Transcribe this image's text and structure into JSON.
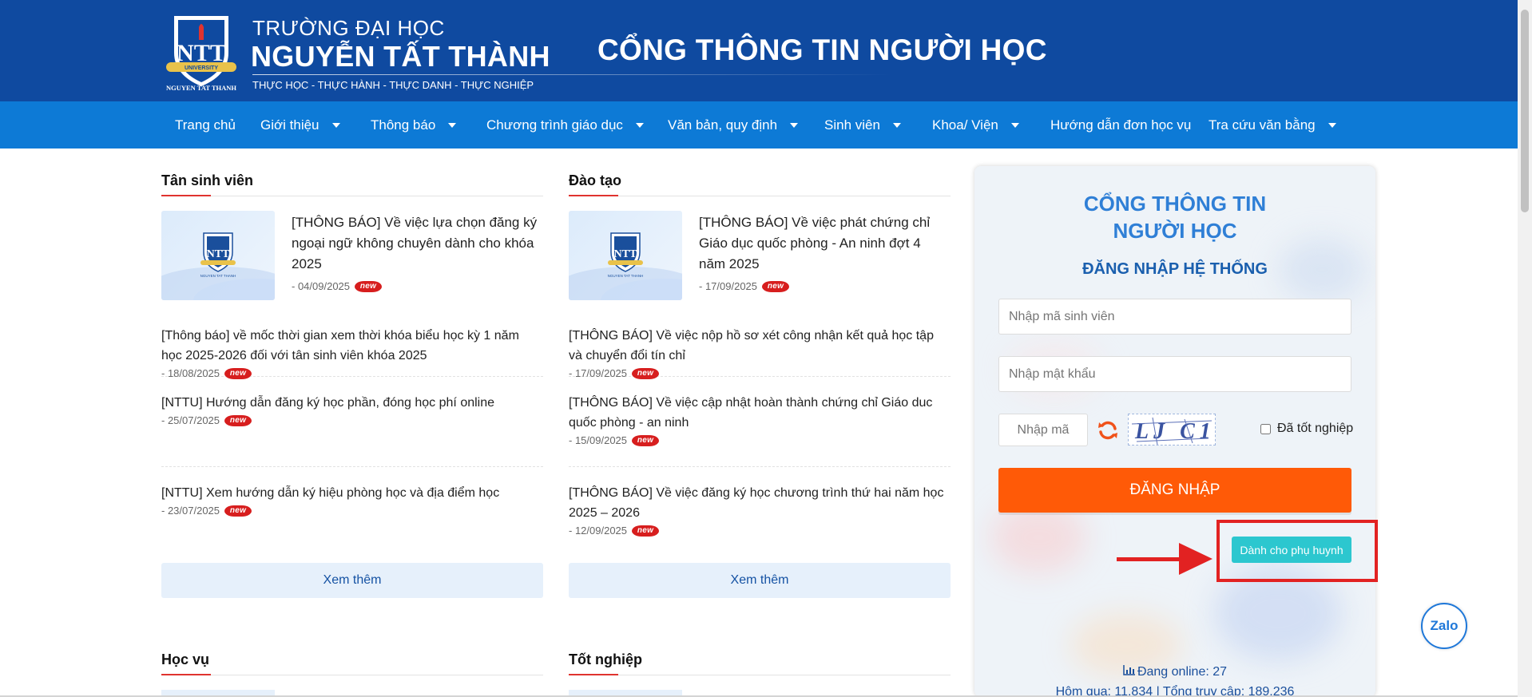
{
  "header": {
    "uni_line1": "TRƯỜNG ĐẠI HỌC",
    "uni_line2": "NGUYỄN TẤT THÀNH",
    "slogan": "THỰC HỌC - THỰC HÀNH - THỰC DANH - THỰC NGHIỆP",
    "portal_title": "CỔNG THÔNG TIN NGƯỜI HỌC",
    "logo_text": "NGUYEN TAT THANH"
  },
  "nav": [
    {
      "label": "Trang chủ",
      "dropdown": false
    },
    {
      "label": "Giới thiệu",
      "dropdown": true
    },
    {
      "label": "Thông báo",
      "dropdown": true
    },
    {
      "label": "Chương trình giáo dục",
      "dropdown": true
    },
    {
      "label": "Văn bản, quy định",
      "dropdown": true
    },
    {
      "label": "Sinh viên",
      "dropdown": true
    },
    {
      "label": "Khoa/ Viện",
      "dropdown": true
    },
    {
      "label": "Hướng dẫn đơn học vụ",
      "dropdown": false
    },
    {
      "label": "Tra cứu văn bằng",
      "dropdown": true
    }
  ],
  "badge_new": "new",
  "sections": {
    "tan_sinh_vien": {
      "title": "Tân sinh viên",
      "featured": {
        "text": "[THÔNG BÁO] Về việc lựa chọn đăng ký ngoại ngữ không chuyên dành cho khóa 2025",
        "date": "- 04/09/2025"
      },
      "items": [
        {
          "text": "[Thông báo] về mốc thời gian xem thời khóa biểu học kỳ 1 năm học 2025-2026 đối với tân sinh viên khóa 2025",
          "date": "- 18/08/2025"
        },
        {
          "text": "[NTTU] Hướng dẫn đăng ký học phần, đóng học phí online",
          "date": "- 25/07/2025"
        },
        {
          "text": "[NTTU] Xem hướng dẫn ký hiệu phòng học và địa điểm học",
          "date": "- 23/07/2025"
        }
      ],
      "more": "Xem thêm"
    },
    "dao_tao": {
      "title": "Đào tạo",
      "featured": {
        "text": "[THÔNG BÁO] Về việc phát chứng chỉ Giáo dục quốc phòng - An ninh đợt 4 năm 2025",
        "date": "- 17/09/2025"
      },
      "items": [
        {
          "text": "[THÔNG BÁO] Về việc nộp hồ sơ xét công nhận kết quả học tập và chuyển đổi tín chỉ",
          "date": "- 17/09/2025"
        },
        {
          "text": "[THÔNG BÁO] Về việc cập nhật hoàn thành chứng chỉ Giáo duc quốc phòng - an ninh",
          "date": "- 15/09/2025"
        },
        {
          "text": "[THÔNG BÁO] Về việc đăng ký học chương trình thứ hai năm học 2025 – 2026",
          "date": "- 12/09/2025"
        }
      ],
      "more": "Xem thêm"
    },
    "hoc_vu": {
      "title": "Học vụ"
    },
    "tot_nghiep": {
      "title": "Tốt nghiệp"
    }
  },
  "login": {
    "title_line1": "CỔNG THÔNG TIN",
    "title_line2": "NGƯỜI HỌC",
    "subtitle": "ĐĂNG NHẬP HỆ THỐNG",
    "student_id_placeholder": "Nhập mã sinh viên",
    "password_placeholder": "Nhập mật khẩu",
    "captcha_placeholder": "Nhập mã",
    "captcha_text": "LJ C1",
    "graduated_label": "Đã tốt nghiệp",
    "login_button": "ĐĂNG NHẬP",
    "parent_button": "Dành cho phụ huynh",
    "online_label": "Đang online: 27",
    "stats": "Hôm qua: 11.834 | Tổng truy cập: 189.236"
  },
  "zalo_label": "Zalo",
  "colors": {
    "header_blue": "#0f4aa0",
    "nav_blue": "#0d7ad6",
    "login_orange": "#ff5a07",
    "parent_teal": "#2cc7cf",
    "annotation_red": "#e22222",
    "new_red": "#d71e1e"
  }
}
